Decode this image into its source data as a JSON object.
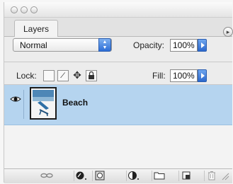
{
  "panel": {
    "tab_label": "Layers",
    "menu_icon": "triangle-right-icon"
  },
  "blend": {
    "mode": "Normal",
    "opacity_label": "Opacity:",
    "opacity_value": "100%"
  },
  "lock": {
    "label": "Lock:",
    "fill_label": "Fill:",
    "fill_value": "100%",
    "icons": [
      "lock-transparent-icon",
      "lock-paint-icon",
      "lock-move-icon",
      "lock-all-icon"
    ]
  },
  "layers": [
    {
      "name": "Beach",
      "visible": true,
      "selected": true,
      "thumb_icon": "beach-chair-icon"
    }
  ],
  "toolbar": {
    "icons": [
      "link-layers-icon",
      "layer-style-icon",
      "layer-mask-icon",
      "adjustment-layer-icon",
      "new-group-icon",
      "new-layer-icon",
      "trash-icon"
    ]
  },
  "colors": {
    "selection": "#b5d4ef",
    "accent_blue": "#2c6dd6"
  }
}
